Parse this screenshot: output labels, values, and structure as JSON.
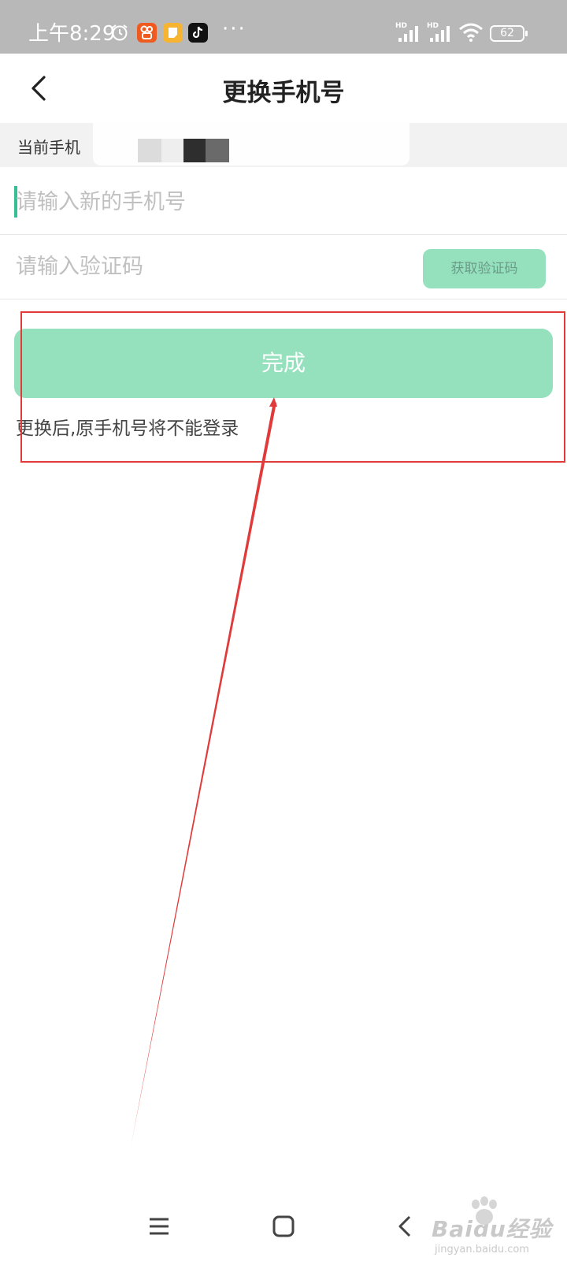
{
  "status_bar": {
    "time": "上午8:29",
    "more": "···",
    "network_1": "HD",
    "network_2": "HD",
    "battery": "62"
  },
  "header": {
    "title": "更换手机号"
  },
  "current_phone": {
    "label": "当前手机"
  },
  "form": {
    "phone_placeholder": "请输入新的手机号",
    "phone_value": "",
    "code_placeholder": "请输入验证码",
    "code_value": "",
    "get_code_label": "获取验证码"
  },
  "submit": {
    "label": "完成"
  },
  "hint": "更换后,原手机号将不能登录",
  "watermark": {
    "main": "Baidu经验",
    "sub": "jingyan.baidu.com"
  },
  "colors": {
    "accent": "#95e0bd",
    "cursor": "#33c097",
    "annotation": "#e03a3a",
    "status_bar": "#b8b8b8"
  },
  "icons": [
    "alarm-icon",
    "app-icon-kuaishou",
    "app-icon-notes",
    "app-icon-tiktok",
    "signal-icon",
    "wifi-icon",
    "battery-icon",
    "back-arrow-icon",
    "menu-icon",
    "home-icon",
    "back-icon"
  ]
}
